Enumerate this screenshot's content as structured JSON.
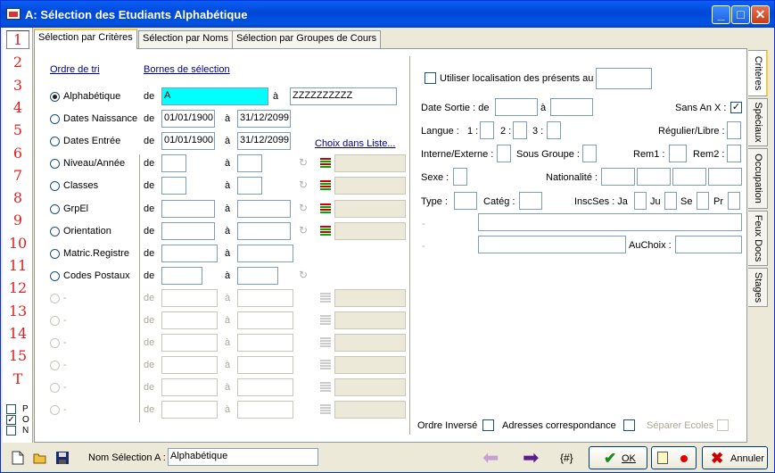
{
  "window": {
    "title": "A: Sélection des Etudiants Alphabétique"
  },
  "left_numbers": [
    "1",
    "2",
    "3",
    "4",
    "5",
    "6",
    "7",
    "8",
    "9",
    "10",
    "11",
    "12",
    "13",
    "14",
    "15",
    "T"
  ],
  "pon": [
    {
      "label": "P",
      "checked": false
    },
    {
      "label": "O",
      "checked": true
    },
    {
      "label": "N",
      "checked": false
    }
  ],
  "tabs": [
    "Sélection par Critères",
    "Sélection par Noms",
    "Sélection par Groupes de Cours"
  ],
  "right_tabs": [
    "Critères",
    "Spéciaux",
    "Occupation",
    "Feux Docs",
    "Stages"
  ],
  "left": {
    "ordre_de_tri": "Ordre de tri",
    "bornes": "Bornes de sélection",
    "choix_liste": "Choix dans Liste...",
    "de": "de",
    "a": "à",
    "rows": [
      {
        "label": "Alphabétique",
        "selected": true,
        "from": "A",
        "to": "ZZZZZZZZZZ"
      },
      {
        "label": "Dates Naissance",
        "from": "01/01/1900",
        "to": "31/12/2099"
      },
      {
        "label": "Dates Entrée",
        "from": "01/01/1900",
        "to": "31/12/2099"
      },
      {
        "label": "Niveau/Année",
        "from": "",
        "to": ""
      },
      {
        "label": "Classes",
        "from": "",
        "to": ""
      },
      {
        "label": "GrpEl",
        "from": "",
        "to": ""
      },
      {
        "label": "Orientation",
        "from": "",
        "to": ""
      },
      {
        "label": "Matric.Registre",
        "from": "",
        "to": ""
      },
      {
        "label": "Codes Postaux",
        "from": "",
        "to": ""
      },
      {
        "label": "-",
        "from": "",
        "to": ""
      },
      {
        "label": "-",
        "from": "",
        "to": ""
      },
      {
        "label": "-",
        "from": "",
        "to": ""
      },
      {
        "label": "-",
        "from": "",
        "to": ""
      },
      {
        "label": "-",
        "from": "",
        "to": ""
      },
      {
        "label": "-",
        "from": "",
        "to": ""
      }
    ]
  },
  "right": {
    "utiliser": "Utiliser localisation des présents au",
    "date_sortie": "Date Sortie :  de",
    "a": "à",
    "sans_an": "Sans An X :",
    "langue": "Langue :",
    "l1": "1 :",
    "l2": "2 :",
    "l3": "3 :",
    "regulier": "Régulier/Libre :",
    "interne": "Interne/Externe :",
    "sous_groupe": "Sous Groupe :",
    "rem1": "Rem1 :",
    "rem2": "Rem2 :",
    "sexe": "Sexe :",
    "nationalite": "Nationalité :",
    "type": "Type :",
    "categ": "Catég :",
    "inscses": "InscSes : Ja",
    "ju": "Ju",
    "se": "Se",
    "pr": "Pr",
    "dash1": "-",
    "dash2": "-",
    "auchoix": "AuChoix :",
    "ordre_inverse": "Ordre Inversé",
    "adresses": "Adresses correspondance",
    "separer": "Séparer Ecoles"
  },
  "bottom": {
    "nom_label": "Nom Sélection A :",
    "nom_value": "Alphabétique",
    "hash": "{#}",
    "ok": "OK",
    "annuler": "Annuler"
  }
}
